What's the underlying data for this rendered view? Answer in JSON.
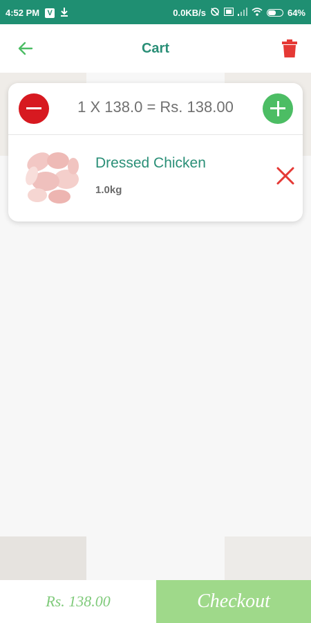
{
  "status_bar": {
    "time": "4:52 PM",
    "network_speed": "0.0KB/s",
    "battery": "64%",
    "battery_level": 0.64
  },
  "header": {
    "title": "Cart",
    "back_icon": "arrow-left-icon",
    "delete_icon": "trash-icon"
  },
  "cart": {
    "quantity_summary": "1 X 138.0 = Rs. 138.00",
    "items": [
      {
        "name": "Dressed Chicken",
        "weight": "1.0kg"
      }
    ]
  },
  "footer": {
    "total": "Rs. 138.00",
    "checkout_label": "Checkout"
  },
  "colors": {
    "status_bar": "#1f8f72",
    "accent": "#2a8f77",
    "minus": "#d71920",
    "plus": "#4cbd64",
    "checkout": "#9fd98a",
    "total_text": "#7fca7a"
  }
}
